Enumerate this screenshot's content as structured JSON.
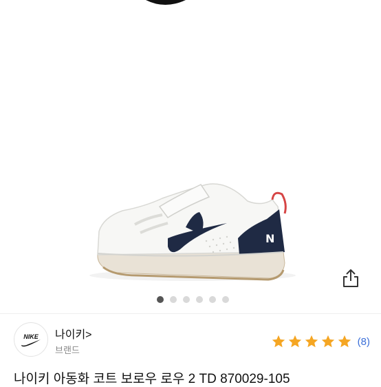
{
  "brand": {
    "name": "나이키>",
    "label": "브랜드",
    "logo_text": "NIKE"
  },
  "rating": {
    "stars": 5,
    "count": "(8)",
    "star_color": "#f5a623"
  },
  "product": {
    "title": "나이키 아동화 코트 보로우 로우 2 TD 870029-105",
    "image_icon": "sneaker-image"
  },
  "pager": {
    "total": 6,
    "active_index": 0
  },
  "icons": {
    "share": "share-icon"
  }
}
